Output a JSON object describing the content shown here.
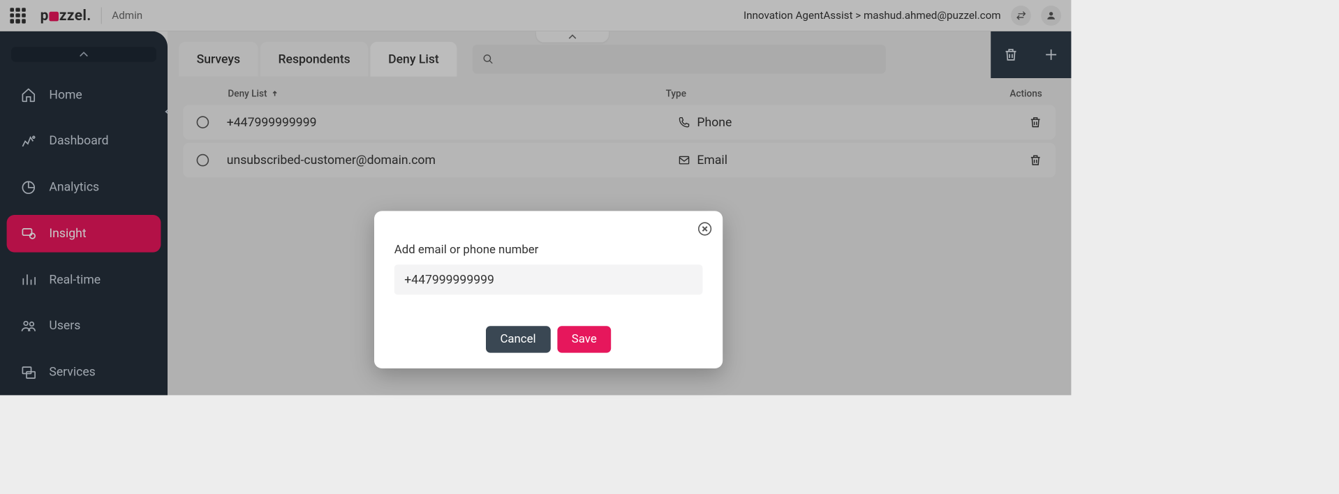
{
  "topbar": {
    "admin_label": "Admin",
    "logo_text_before": "p",
    "logo_text_after": "zzel.",
    "breadcrumb": "Innovation AgentAssist > mashud.ahmed@puzzel.com"
  },
  "sidebar": {
    "items": [
      {
        "label": "Home"
      },
      {
        "label": "Dashboard"
      },
      {
        "label": "Analytics"
      },
      {
        "label": "Insight"
      },
      {
        "label": "Real-time"
      },
      {
        "label": "Users"
      },
      {
        "label": "Services"
      }
    ]
  },
  "tabs": {
    "surveys": "Surveys",
    "respondents": "Respondents",
    "denylist": "Deny List"
  },
  "search": {
    "placeholder": ""
  },
  "table": {
    "headers": {
      "entry": "Deny List",
      "type": "Type",
      "actions": "Actions"
    },
    "rows": [
      {
        "entry": "+447999999999",
        "type": "Phone"
      },
      {
        "entry": "unsubscribed-customer@domain.com",
        "type": "Email"
      }
    ]
  },
  "modal": {
    "label": "Add email or phone number",
    "value": "+447999999999",
    "cancel": "Cancel",
    "save": "Save"
  }
}
